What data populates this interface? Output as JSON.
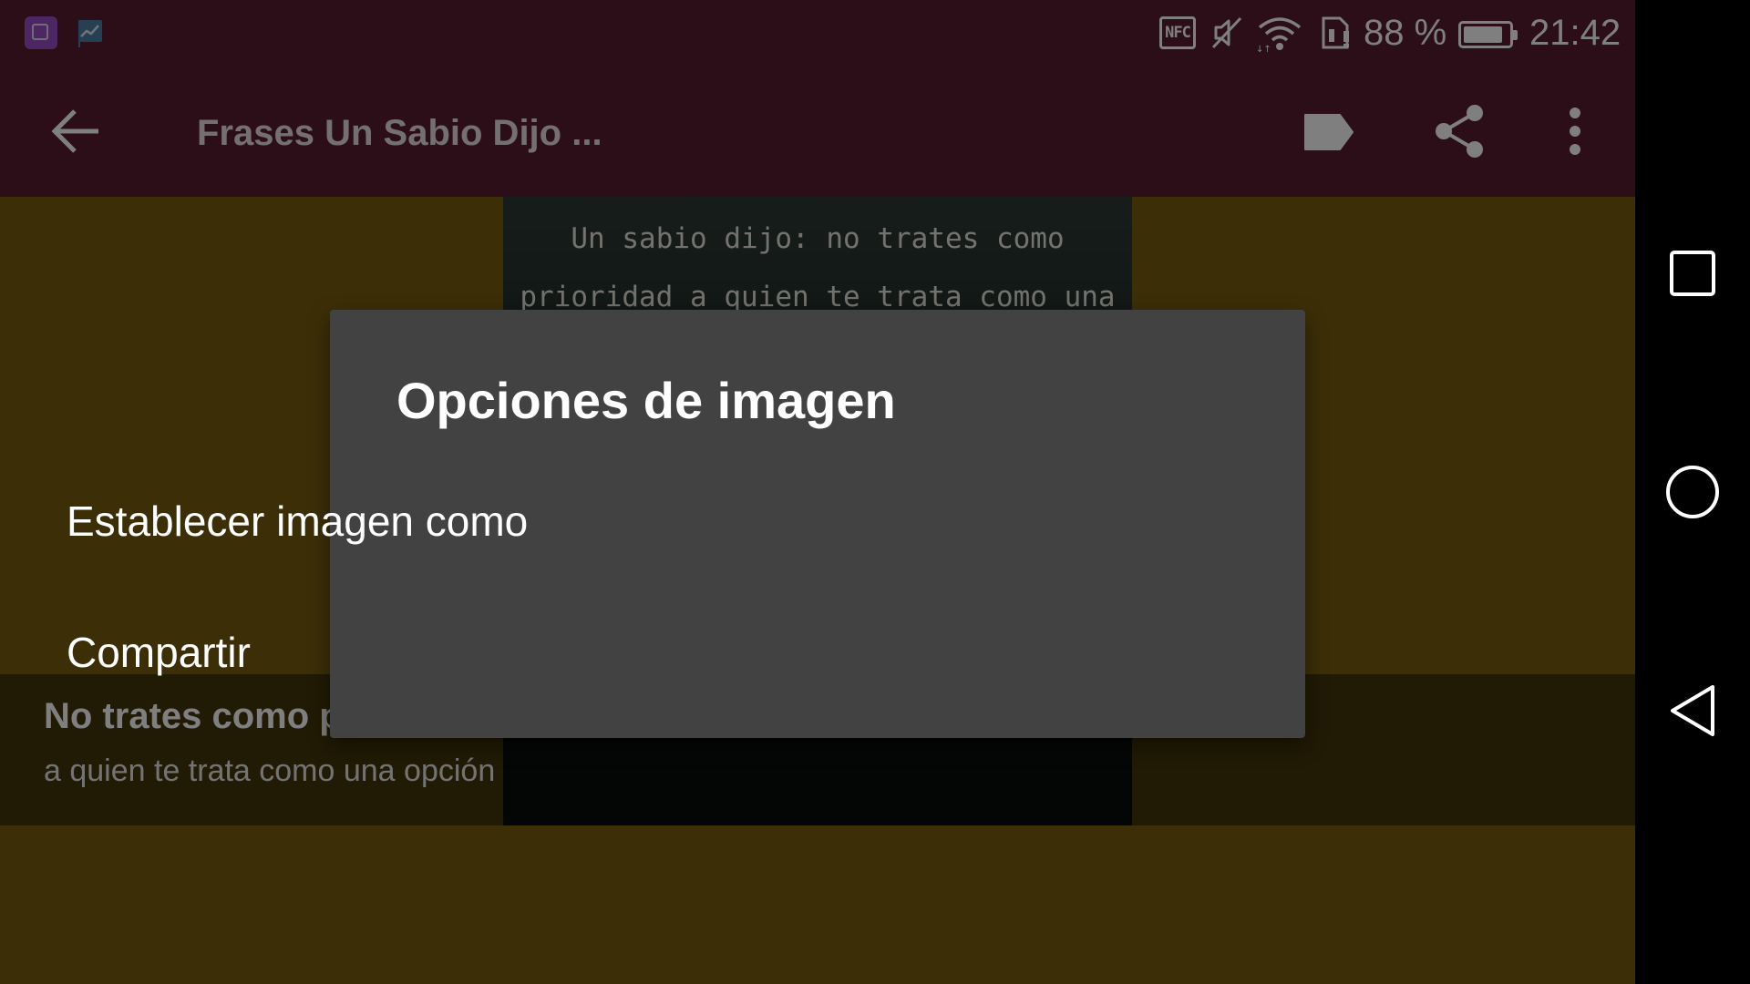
{
  "status_bar": {
    "battery_pct_text": "88 %",
    "battery_level": 0.88,
    "time": "21:42",
    "nfc_label": "NFC",
    "icons": [
      "gallery-app-icon",
      "chart-flag-icon",
      "nfc-icon",
      "mute-icon",
      "wifi-icon",
      "sim-icon",
      "battery-icon"
    ]
  },
  "toolbar": {
    "title": "Frases Un Sabio Dijo ...",
    "icons": [
      "back-arrow-icon",
      "label-tag-icon",
      "share-icon",
      "more-vert-icon"
    ]
  },
  "content": {
    "image_text": "Un sabio dijo: no trates como prioridad a quien te trata como una opción.",
    "caption_title": "No trates como prioridad",
    "caption_subtitle": "a quien te trata como una opción"
  },
  "dialog": {
    "title": "Opciones de imagen",
    "items": [
      {
        "label": "Establecer imagen como"
      },
      {
        "label": "Compartir"
      }
    ]
  },
  "nav_bar": {
    "icons": [
      "recents-square-icon",
      "home-circle-icon",
      "back-triangle-icon"
    ]
  },
  "colors": {
    "app_bar": "#571d2e",
    "content_bg": "#785f10",
    "dialog_bg": "#424242",
    "nav_bg": "#000000"
  }
}
